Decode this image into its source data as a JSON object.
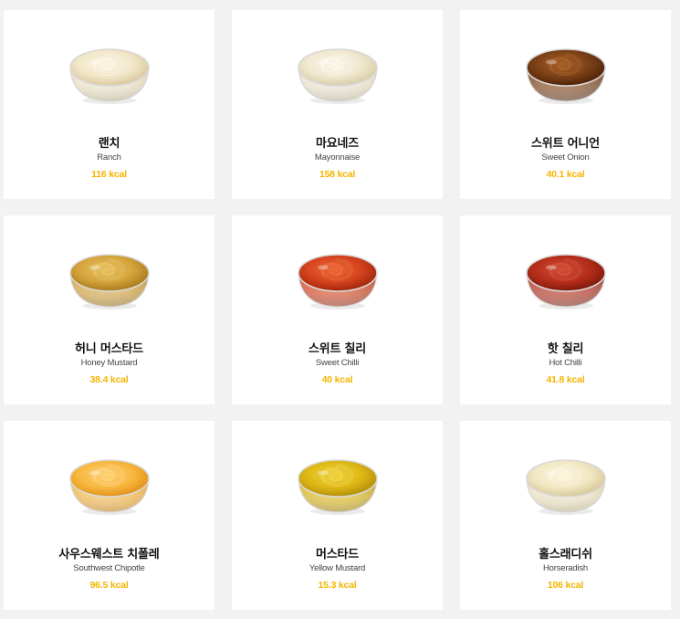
{
  "sauces": [
    {
      "name_ko": "랜치",
      "name_en": "Ranch",
      "kcal": "116 kcal",
      "icon": "ranch-sauce-bowl-icon",
      "colors": {
        "main": "#f1e6c8",
        "light": "#fbf5e2",
        "dark": "#d9c89f"
      }
    },
    {
      "name_ko": "마요네즈",
      "name_en": "Mayonnaise",
      "kcal": "158 kcal",
      "icon": "mayonnaise-sauce-bowl-icon",
      "colors": {
        "main": "#f0e7ce",
        "light": "#fbf7ea",
        "dark": "#d8cca9"
      }
    },
    {
      "name_ko": "스위트 어니언",
      "name_en": "Sweet Onion",
      "kcal": "40.1 kcal",
      "icon": "sweet-onion-sauce-bowl-icon",
      "colors": {
        "main": "#7a3f16",
        "light": "#a8622a",
        "dark": "#4f2408"
      }
    },
    {
      "name_ko": "허니 머스타드",
      "name_en": "Honey Mustard",
      "kcal": "38.4 kcal",
      "icon": "honey-mustard-sauce-bowl-icon",
      "colors": {
        "main": "#d4a23a",
        "light": "#e8c264",
        "dark": "#a97a1e"
      }
    },
    {
      "name_ko": "스위트 칠리",
      "name_en": "Sweet Chilli",
      "kcal": "40 kcal",
      "icon": "sweet-chilli-sauce-bowl-icon",
      "colors": {
        "main": "#d4421e",
        "light": "#ec6a3a",
        "dark": "#a1260c"
      }
    },
    {
      "name_ko": "핫 칠리",
      "name_en": "Hot Chilli",
      "kcal": "41.8 kcal",
      "icon": "hot-chilli-sauce-bowl-icon",
      "colors": {
        "main": "#b52d1a",
        "light": "#d2503a",
        "dark": "#7f1a0c"
      }
    },
    {
      "name_ko": "사우스웨스트 치폴레",
      "name_en": "Southwest Chipotle",
      "kcal": "96.5 kcal",
      "icon": "southwest-chipotle-sauce-bowl-icon",
      "colors": {
        "main": "#f7b73e",
        "light": "#ffd27a",
        "dark": "#e3921c"
      }
    },
    {
      "name_ko": "머스타드",
      "name_en": "Yellow Mustard",
      "kcal": "15.3 kcal",
      "icon": "yellow-mustard-sauce-bowl-icon",
      "colors": {
        "main": "#ddb714",
        "light": "#f0d444",
        "dark": "#b3900a"
      }
    },
    {
      "name_ko": "홀스래디쉬",
      "name_en": "Horseradish",
      "kcal": "106 kcal",
      "icon": "horseradish-sauce-bowl-icon",
      "colors": {
        "main": "#f1e7c2",
        "light": "#fbf6df",
        "dark": "#d8c99a"
      }
    }
  ]
}
